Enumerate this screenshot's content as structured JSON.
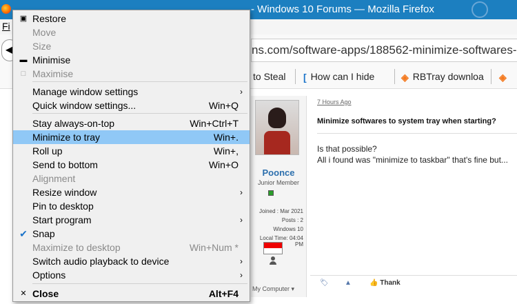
{
  "browser": {
    "window_title": "Minimize softwares to system tray when starting? - Windows 10 Forums — Mozilla Firefox",
    "title_visible": "- Windows 10 Forums — Mozilla Firefox",
    "menu_file": "Fi",
    "url_visible": "ns.com/software-apps/188562-minimize-softwares-syste",
    "back_glyph": "◀",
    "bookmarks": [
      {
        "label": "to Steal",
        "icon": "page-icon"
      },
      {
        "label": "How can I hide",
        "icon": "bracket-icon"
      },
      {
        "label": "RBTray downloa",
        "icon": "sourceforge-icon"
      },
      {
        "label": "",
        "icon": "sourceforge-icon"
      }
    ]
  },
  "post": {
    "ago": "7 Hours Ago",
    "title": "Minimize softwares to system tray when starting?",
    "body": [
      "Is that possible?",
      "All i found was \"minimize to taskbar\" that's fine but..."
    ],
    "user": {
      "name": "Poonce",
      "title": "Junior Member",
      "joined": "Joined : Mar 2021",
      "posts": "Posts : 2",
      "os": "Windows 10",
      "local_time": "Local Time: 04:04 PM",
      "my_computer": "My Computer"
    },
    "thanks": "Thank"
  },
  "menu": {
    "items": [
      {
        "label": "Restore",
        "accel": "",
        "disabled": false,
        "submenu": false,
        "glyph": "▣",
        "highlight": false,
        "bold": false
      },
      {
        "label": "Move",
        "accel": "",
        "disabled": true,
        "submenu": false,
        "glyph": "",
        "highlight": false,
        "bold": false
      },
      {
        "label": "Size",
        "accel": "",
        "disabled": true,
        "submenu": false,
        "glyph": "",
        "highlight": false,
        "bold": false
      },
      {
        "label": "Minimise",
        "accel": "",
        "disabled": false,
        "submenu": false,
        "glyph": "▬",
        "highlight": false,
        "bold": false
      },
      {
        "label": "Maximise",
        "accel": "",
        "disabled": true,
        "submenu": false,
        "glyph": "□",
        "highlight": false,
        "bold": false
      },
      {
        "label": "Manage window settings",
        "accel": "",
        "disabled": false,
        "submenu": true,
        "glyph": "",
        "highlight": false,
        "bold": false
      },
      {
        "label": "Quick window settings...",
        "accel": "Win+Q",
        "disabled": false,
        "submenu": false,
        "glyph": "",
        "highlight": false,
        "bold": false
      },
      {
        "label": "Stay always-on-top",
        "accel": "Win+Ctrl+T",
        "disabled": false,
        "submenu": false,
        "glyph": "",
        "highlight": false,
        "bold": false
      },
      {
        "label": "Minimize to tray",
        "accel": "Win+.",
        "disabled": false,
        "submenu": false,
        "glyph": "",
        "highlight": true,
        "bold": false
      },
      {
        "label": "Roll up",
        "accel": "Win+,",
        "disabled": false,
        "submenu": false,
        "glyph": "",
        "highlight": false,
        "bold": false
      },
      {
        "label": "Send to bottom",
        "accel": "Win+O",
        "disabled": false,
        "submenu": false,
        "glyph": "",
        "highlight": false,
        "bold": false
      },
      {
        "label": "Alignment",
        "accel": "",
        "disabled": true,
        "submenu": false,
        "glyph": "",
        "highlight": false,
        "bold": false
      },
      {
        "label": "Resize window",
        "accel": "",
        "disabled": false,
        "submenu": true,
        "glyph": "",
        "highlight": false,
        "bold": false
      },
      {
        "label": "Pin to desktop",
        "accel": "",
        "disabled": false,
        "submenu": false,
        "glyph": "",
        "highlight": false,
        "bold": false
      },
      {
        "label": "Start program",
        "accel": "",
        "disabled": false,
        "submenu": true,
        "glyph": "",
        "highlight": false,
        "bold": false
      },
      {
        "label": "Snap",
        "accel": "",
        "disabled": false,
        "submenu": false,
        "glyph": "✔",
        "highlight": false,
        "bold": false
      },
      {
        "label": "Maximize to desktop",
        "accel": "Win+Num *",
        "disabled": true,
        "submenu": false,
        "glyph": "",
        "highlight": false,
        "bold": false
      },
      {
        "label": "Switch audio playback to device",
        "accel": "",
        "disabled": false,
        "submenu": true,
        "glyph": "",
        "highlight": false,
        "bold": false
      },
      {
        "label": "Options",
        "accel": "",
        "disabled": false,
        "submenu": true,
        "glyph": "",
        "highlight": false,
        "bold": false
      },
      {
        "label": "Close",
        "accel": "Alt+F4",
        "disabled": false,
        "submenu": false,
        "glyph": "✕",
        "highlight": false,
        "bold": true
      }
    ],
    "submenu_arrow": "›",
    "colors": {
      "highlight": "#90c8f6",
      "disabled_text": "#8a8a8a",
      "check": "#1a73c9"
    }
  }
}
